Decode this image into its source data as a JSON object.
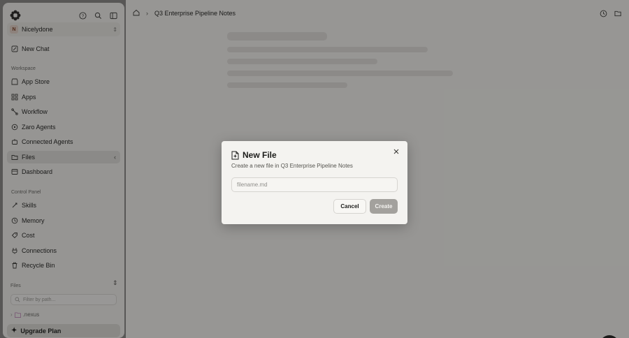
{
  "sidebar": {
    "org": {
      "badge": "N",
      "name": "Nicelydone"
    },
    "new_chat": "New Chat",
    "workspace_label": "Workspace",
    "workspace_items": [
      {
        "label": "App Store",
        "icon": "store-icon"
      },
      {
        "label": "Apps",
        "icon": "apps-grid-icon"
      },
      {
        "label": "Workflow",
        "icon": "workflow-icon"
      },
      {
        "label": "Zaro Agents",
        "icon": "agents-icon"
      },
      {
        "label": "Connected Agents",
        "icon": "connected-agents-icon"
      },
      {
        "label": "Files",
        "icon": "folder-icon",
        "active": true
      },
      {
        "label": "Dashboard",
        "icon": "dashboard-icon"
      }
    ],
    "control_label": "Control Panel",
    "control_items": [
      {
        "label": "Skills",
        "icon": "skills-icon"
      },
      {
        "label": "Memory",
        "icon": "memory-icon"
      },
      {
        "label": "Cost",
        "icon": "cost-icon"
      },
      {
        "label": "Connections",
        "icon": "connections-icon"
      },
      {
        "label": "Recycle Bin",
        "icon": "trash-icon"
      }
    ],
    "files_label": "Files",
    "filter_placeholder": "Filter by path...",
    "tree_folder": ".nexus",
    "upgrade": "Upgrade Plan"
  },
  "breadcrumb": {
    "current": "Q3 Enterprise Pipeline Notes"
  },
  "dialog": {
    "title": "New File",
    "description": "Create a new file in Q3 Enterprise Pipeline Notes",
    "input_placeholder": "filename.md",
    "input_value": "",
    "cancel": "Cancel",
    "create": "Create"
  },
  "colors": {
    "overlay": "#14141270",
    "create_disabled": "#a3a19d",
    "active_item": "#e2e0dc"
  }
}
